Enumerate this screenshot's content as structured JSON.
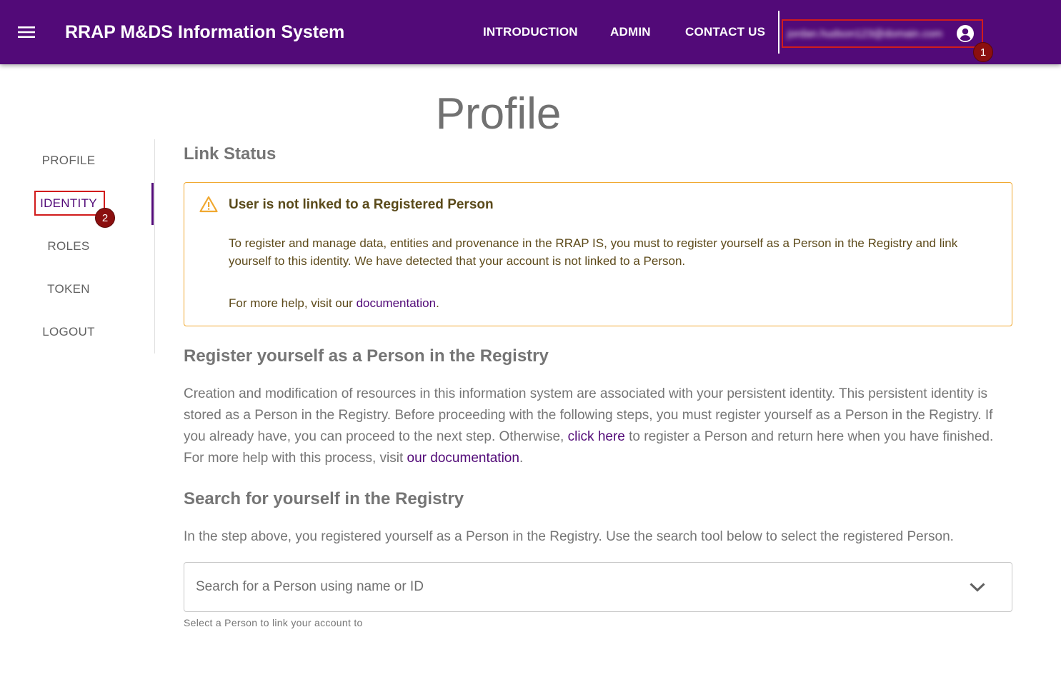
{
  "app": {
    "title": "RRAP M&DS Information System"
  },
  "nav": {
    "introduction": "INTRODUCTION",
    "admin": "ADMIN",
    "contact": "CONTACT US",
    "user_email": "jordan.hudson123@domain.com"
  },
  "annotations": {
    "badge1": "1",
    "badge2": "2"
  },
  "page": {
    "title": "Profile"
  },
  "sidebar": {
    "items": [
      {
        "label": "PROFILE"
      },
      {
        "label": "IDENTITY"
      },
      {
        "label": "ROLES"
      },
      {
        "label": "TOKEN"
      },
      {
        "label": "LOGOUT"
      }
    ]
  },
  "link_status": {
    "heading": "Link Status",
    "alert_title": "User is not linked to a Registered Person",
    "alert_body": "To register and manage data, entities and provenance in the RRAP IS, you must to register yourself as a Person in the Registry and link yourself to this identity. We have detected that your account is not linked to a Person.",
    "help_prefix": "For more help, visit our ",
    "help_link": "documentation",
    "help_suffix": "."
  },
  "register": {
    "heading": "Register yourself as a Person in the Registry",
    "text_before": "Creation and modification of resources in this information system are associated with your persistent identity. This persistent identity is stored as a Person in the Registry. Before proceeding with the following steps, you must register yourself as a Person in the Registry. If you already have, you can proceed to the next step. Otherwise, ",
    "click_here": "click here",
    "text_middle": " to register a Person and return here when you have finished. For more help with this process, visit ",
    "doc_link": "our documentation",
    "text_after": "."
  },
  "search": {
    "heading": "Search for yourself in the Registry",
    "text": "In the step above, you registered yourself as a Person in the Registry. Use the search tool below to select the registered Person.",
    "placeholder": "Search for a Person using name or ID",
    "helper": "Select a Person to link your account to"
  },
  "colors": {
    "brand": "#520a78",
    "warning_border": "#f0a830",
    "annotation_red": "#d11c1c",
    "badge": "#8b0f0f"
  }
}
